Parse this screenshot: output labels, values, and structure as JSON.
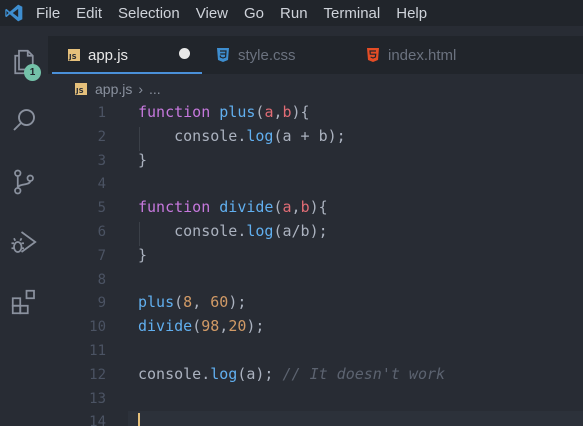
{
  "menu": [
    "File",
    "Edit",
    "Selection",
    "View",
    "Go",
    "Run",
    "Terminal",
    "Help"
  ],
  "activity_bar": {
    "items": [
      {
        "name": "explorer",
        "icon": "files-icon"
      },
      {
        "name": "search",
        "icon": "search-icon"
      },
      {
        "name": "source-control",
        "icon": "source-control-icon"
      },
      {
        "name": "run-debug",
        "icon": "debug-icon"
      },
      {
        "name": "extensions",
        "icon": "extensions-icon"
      }
    ],
    "explorer_badge": "1"
  },
  "tabs": [
    {
      "label": "app.js",
      "icon": "js-icon",
      "active": true,
      "modified": true
    },
    {
      "label": "style.css",
      "icon": "css-icon",
      "active": false
    },
    {
      "label": "index.html",
      "icon": "html-icon",
      "active": false
    }
  ],
  "breadcrumb": {
    "file": "app.js",
    "more": "..."
  },
  "editor": {
    "line_numbers": [
      "1",
      "2",
      "3",
      "4",
      "5",
      "6",
      "7",
      "8",
      "9",
      "10",
      "11",
      "12",
      "13",
      "14"
    ],
    "lines": [
      [
        {
          "t": "kw",
          "v": "function"
        },
        {
          "t": "pl",
          "v": " "
        },
        {
          "t": "fn",
          "v": "plus"
        },
        {
          "t": "pl",
          "v": "("
        },
        {
          "t": "par",
          "v": "a"
        },
        {
          "t": "pl",
          "v": ","
        },
        {
          "t": "par",
          "v": "b"
        },
        {
          "t": "pl",
          "v": "){"
        }
      ],
      [
        {
          "t": "pl",
          "v": "    console."
        },
        {
          "t": "fn",
          "v": "log"
        },
        {
          "t": "pl",
          "v": "(a + b);"
        }
      ],
      [
        {
          "t": "pl",
          "v": "}"
        }
      ],
      [],
      [
        {
          "t": "kw",
          "v": "function"
        },
        {
          "t": "pl",
          "v": " "
        },
        {
          "t": "fn",
          "v": "divide"
        },
        {
          "t": "pl",
          "v": "("
        },
        {
          "t": "par",
          "v": "a"
        },
        {
          "t": "pl",
          "v": ","
        },
        {
          "t": "par",
          "v": "b"
        },
        {
          "t": "pl",
          "v": "){"
        }
      ],
      [
        {
          "t": "pl",
          "v": "    console."
        },
        {
          "t": "fn",
          "v": "log"
        },
        {
          "t": "pl",
          "v": "(a/b);"
        }
      ],
      [
        {
          "t": "pl",
          "v": "}"
        }
      ],
      [],
      [
        {
          "t": "fn",
          "v": "plus"
        },
        {
          "t": "pl",
          "v": "("
        },
        {
          "t": "num",
          "v": "8"
        },
        {
          "t": "pl",
          "v": ", "
        },
        {
          "t": "num",
          "v": "60"
        },
        {
          "t": "pl",
          "v": ");"
        }
      ],
      [
        {
          "t": "fn",
          "v": "divide"
        },
        {
          "t": "pl",
          "v": "("
        },
        {
          "t": "num",
          "v": "98"
        },
        {
          "t": "pl",
          "v": ","
        },
        {
          "t": "num",
          "v": "20"
        },
        {
          "t": "pl",
          "v": ");"
        }
      ],
      [],
      [
        {
          "t": "pl",
          "v": "console."
        },
        {
          "t": "fn",
          "v": "log"
        },
        {
          "t": "pl",
          "v": "(a); "
        },
        {
          "t": "cmt",
          "v": "// It doesn't work"
        }
      ],
      [],
      []
    ]
  },
  "colors": {
    "background": "#282c34",
    "titlebar": "#21252b",
    "keyword": "#c678dd",
    "function": "#61afef",
    "parameter": "#e06c75",
    "number": "#d19a66",
    "comment": "#5c6370",
    "accent": "#4a90d9",
    "badge": "#73c1a8"
  }
}
